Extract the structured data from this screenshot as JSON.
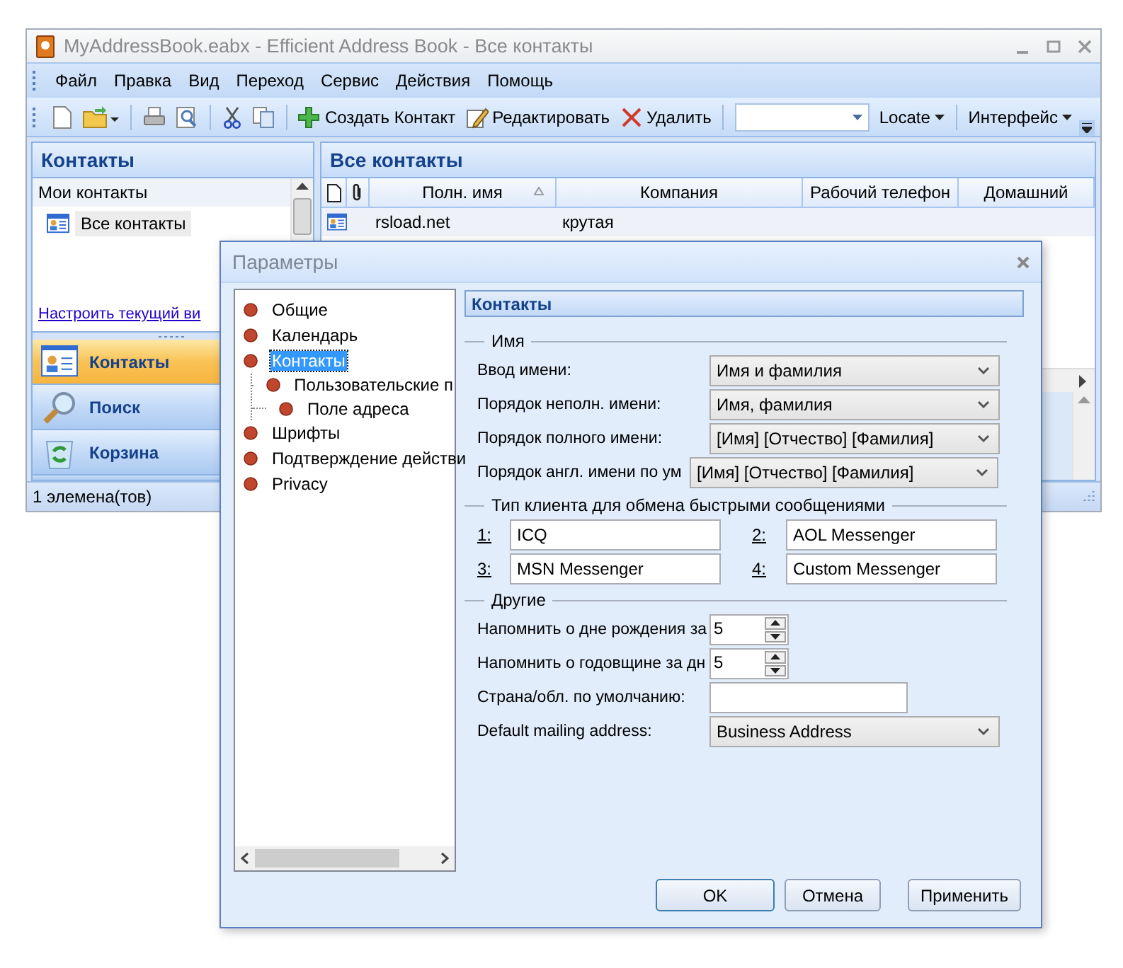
{
  "main_window": {
    "title": "MyAddressBook.eabx - Efficient Address Book - Все контакты",
    "menu": [
      "Файл",
      "Правка",
      "Вид",
      "Переход",
      "Сервис",
      "Действия",
      "Помощь"
    ],
    "toolbar": {
      "actions": [
        "Создать Контакт",
        "Редактировать",
        "Удалить"
      ],
      "menus": [
        "Locate",
        "Интерфейс"
      ]
    },
    "left_pane": {
      "title": "Контакты",
      "section": "Мои контакты",
      "folders": [
        {
          "label": "Все контакты",
          "selected": true
        }
      ],
      "customize_link": "Настроить текущий ви",
      "nav": [
        {
          "label": "Контакты",
          "selected": true
        },
        {
          "label": "Поиск",
          "selected": false
        },
        {
          "label": "Корзина",
          "selected": false
        }
      ]
    },
    "contacts": {
      "title": "Все контакты",
      "columns": [
        "Полн. имя",
        "Компания",
        "Рабочий телефон",
        "Домашний"
      ],
      "rows": [
        {
          "cells": [
            "rsload.net",
            "крутая"
          ]
        }
      ]
    },
    "status_bar": "1 элемена(тов)"
  },
  "dialog": {
    "title": "Параметры",
    "tree": [
      {
        "label": "Общие",
        "selected": false
      },
      {
        "label": "Календарь",
        "selected": false
      },
      {
        "label": "Контакты",
        "selected": true,
        "children": [
          {
            "label": "Пользовательские п",
            "selected": false
          },
          {
            "label": "Поле адреса",
            "selected": false
          }
        ]
      },
      {
        "label": "Шрифты",
        "selected": false
      },
      {
        "label": "Подтверждение действи",
        "selected": false
      },
      {
        "label": "Privacy",
        "selected": false
      }
    ],
    "page_title": "Контакты",
    "groups": [
      {
        "title": "Имя",
        "kind": "rows",
        "rows": [
          {
            "kind": "combo",
            "label": "Ввод имени:",
            "value": "Имя и фамилия"
          },
          {
            "kind": "combo",
            "label": "Порядок неполн. имени:",
            "value": "Имя, фамилия"
          },
          {
            "kind": "combo",
            "label": "Порядок полного имени:",
            "value": "[Имя] [Отчество] [Фамилия]"
          },
          {
            "kind": "combo",
            "label": "Порядок англ. имени по ум",
            "value": "[Имя] [Отчество] [Фамилия]"
          }
        ]
      },
      {
        "title": "Тип клиента для обмена быстрыми сообщениями",
        "kind": "messengers",
        "fields": [
          {
            "number": "1:",
            "value": "ICQ"
          },
          {
            "number": "2:",
            "value": "AOL Messenger"
          },
          {
            "number": "3:",
            "value": "MSN Messenger"
          },
          {
            "number": "4:",
            "value": "Custom Messenger"
          }
        ]
      },
      {
        "title": "Другие",
        "kind": "rows",
        "rows": [
          {
            "kind": "spin",
            "label": "Напомнить о дне рождения за",
            "value": "5"
          },
          {
            "kind": "spin",
            "label": "Напомнить о годовщине за дн",
            "value": "5"
          },
          {
            "kind": "text",
            "label": "Страна/обл. по умолчанию:"
          },
          {
            "kind": "combo",
            "label": "Default mailing address:",
            "value": "Business Address"
          }
        ]
      }
    ],
    "buttons": [
      "OK",
      "Отмена",
      "Применить"
    ]
  }
}
